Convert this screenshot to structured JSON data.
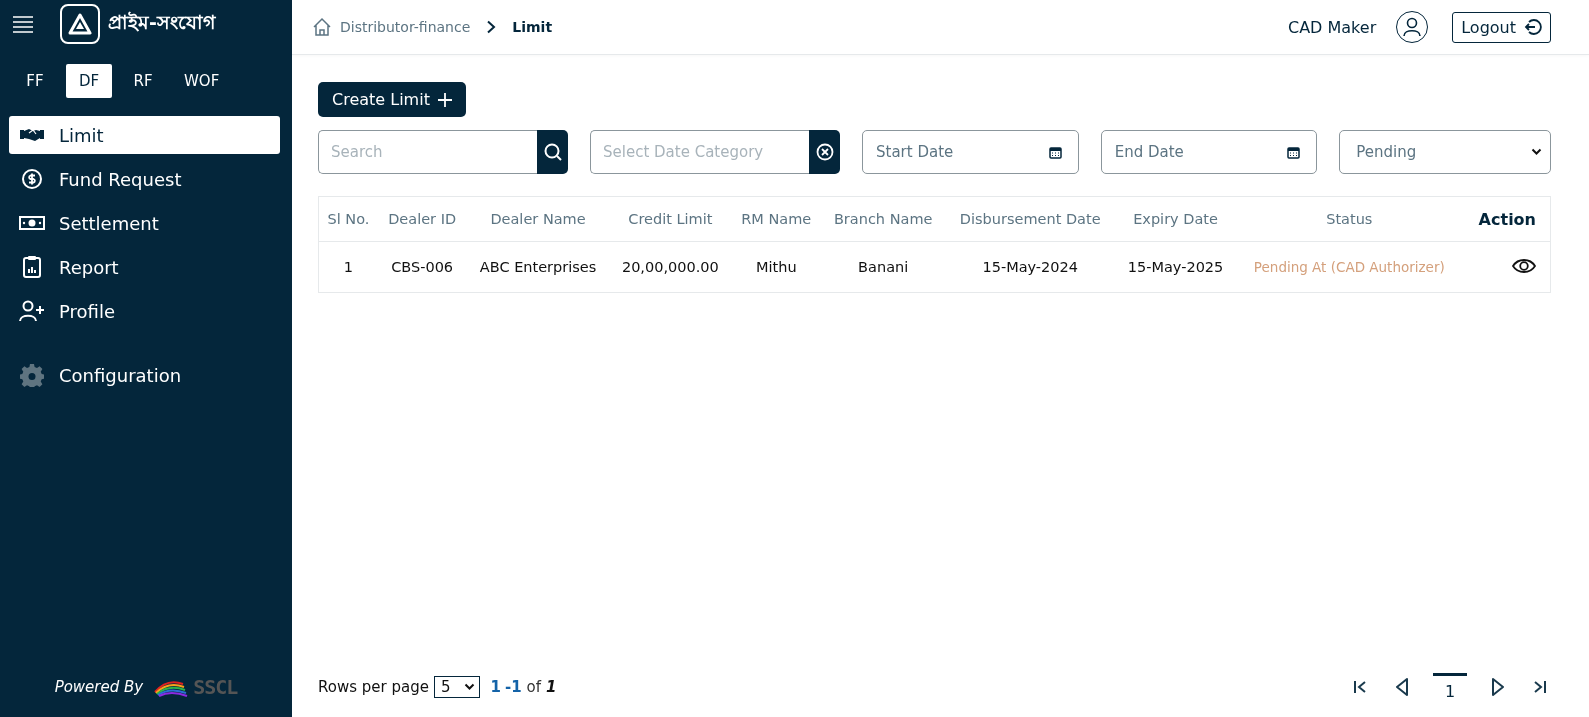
{
  "sidebar": {
    "brand": "প্রাইম-সংযোগ",
    "modules": [
      {
        "label": "FF",
        "selected": false
      },
      {
        "label": "DF",
        "selected": true
      },
      {
        "label": "RF",
        "selected": false
      },
      {
        "label": "WOF",
        "selected": false
      }
    ],
    "items": [
      {
        "label": "Limit",
        "kind": "handshake",
        "selected": true
      },
      {
        "label": "Fund Request",
        "kind": "dollar",
        "selected": false
      },
      {
        "label": "Settlement",
        "kind": "cash",
        "selected": false
      },
      {
        "label": "Report",
        "kind": "clipboard",
        "selected": false
      },
      {
        "label": "Profile",
        "kind": "user-plus",
        "selected": false
      }
    ],
    "bottom_items": [
      {
        "label": "Configuration",
        "kind": "gear",
        "selected": false
      }
    ],
    "powered_by": "Powered By",
    "powered_logo": "SSCL"
  },
  "breadcrumb": [
    "Distributor-finance",
    "Limit"
  ],
  "user": {
    "name": "CAD Maker",
    "logout": "Logout"
  },
  "create_button": "Create Limit",
  "filters": {
    "search": {
      "placeholder": "Search"
    },
    "date_category": {
      "placeholder": "Select Date Category"
    },
    "start_date": {
      "placeholder": "Start Date"
    },
    "end_date": {
      "placeholder": "End Date"
    },
    "status": {
      "value": "Pending"
    }
  },
  "table": {
    "columns": [
      "Sl No.",
      "Dealer ID",
      "Dealer Name",
      "Credit Limit",
      "RM Name",
      "Branch Name",
      "Disbursement Date",
      "Expiry Date",
      "Status",
      "Action"
    ],
    "rows": [
      {
        "cells": [
          "1",
          "CBS-006",
          "ABC Enterprises",
          "20,00,000.00",
          "Mithu",
          "Banani",
          "15-May-2024",
          "15-May-2025",
          "Pending At (CAD Authorizer)"
        ]
      }
    ]
  },
  "pagination": {
    "rows_per_page_label": "Rows per page",
    "rows_per_page": "5",
    "range_start": "1",
    "range_end": "-1",
    "of": "of",
    "total": "1",
    "pages": [
      {
        "label": "1",
        "selected": true
      }
    ]
  }
}
